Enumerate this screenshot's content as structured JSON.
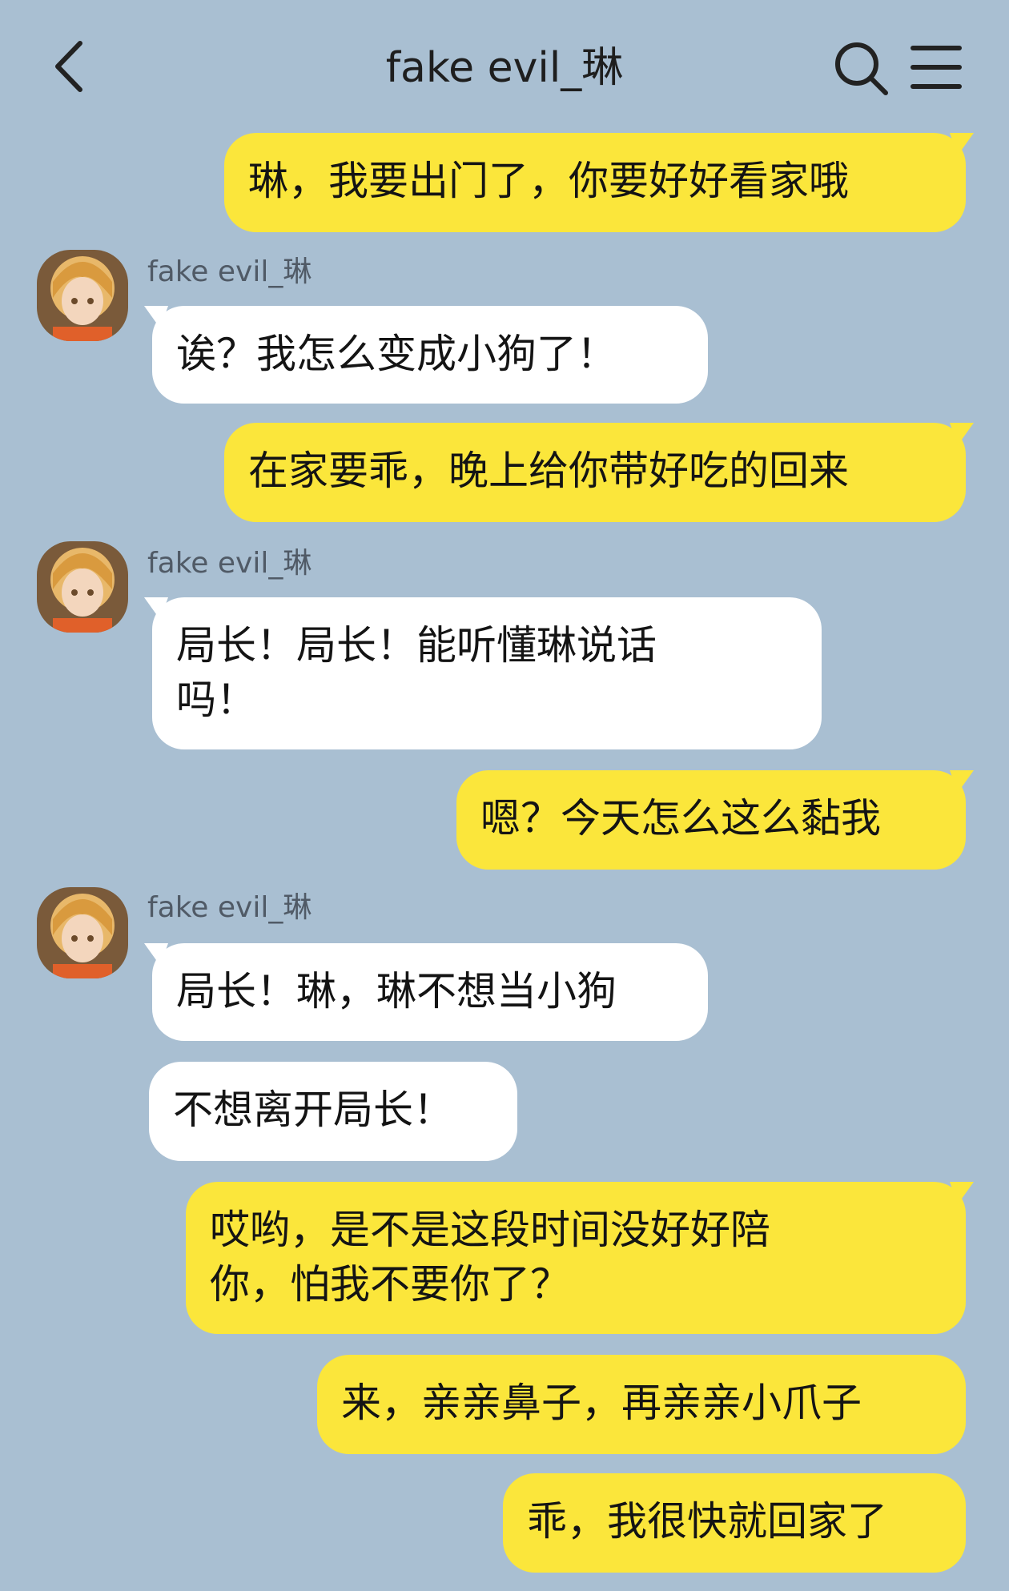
{
  "header": {
    "title": "fake evil_琳",
    "back_icon": "chevron-left-icon",
    "search_icon": "search-icon",
    "menu_icon": "hamburger-menu-icon"
  },
  "colors": {
    "background": "#a9bfd2",
    "my_bubble": "#fbe63b",
    "their_bubble": "#ffffff"
  },
  "messages": [
    {
      "from": "me",
      "text": "琳，我要出门了，你要好好看家哦"
    },
    {
      "from": "them",
      "sender": "fake evil_琳",
      "text": "诶？我怎么变成小狗了！"
    },
    {
      "from": "me",
      "text": "在家要乖，晚上给你带好吃的回来"
    },
    {
      "from": "them",
      "sender": "fake evil_琳",
      "text": "局长！局长！能听懂琳说话\n吗！"
    },
    {
      "from": "me",
      "text": "嗯？今天怎么这么黏我"
    },
    {
      "from": "them",
      "sender": "fake evil_琳",
      "text": "局长！琳，琳不想当小狗"
    },
    {
      "from": "them",
      "text": "不想离开局长！"
    },
    {
      "from": "me",
      "text": "哎哟，是不是这段时间没好好陪\n你，怕我不要你了？"
    },
    {
      "from": "me",
      "text": "来，亲亲鼻子，再亲亲小爪子"
    },
    {
      "from": "me",
      "text": "乖，我很快就回家了"
    }
  ]
}
